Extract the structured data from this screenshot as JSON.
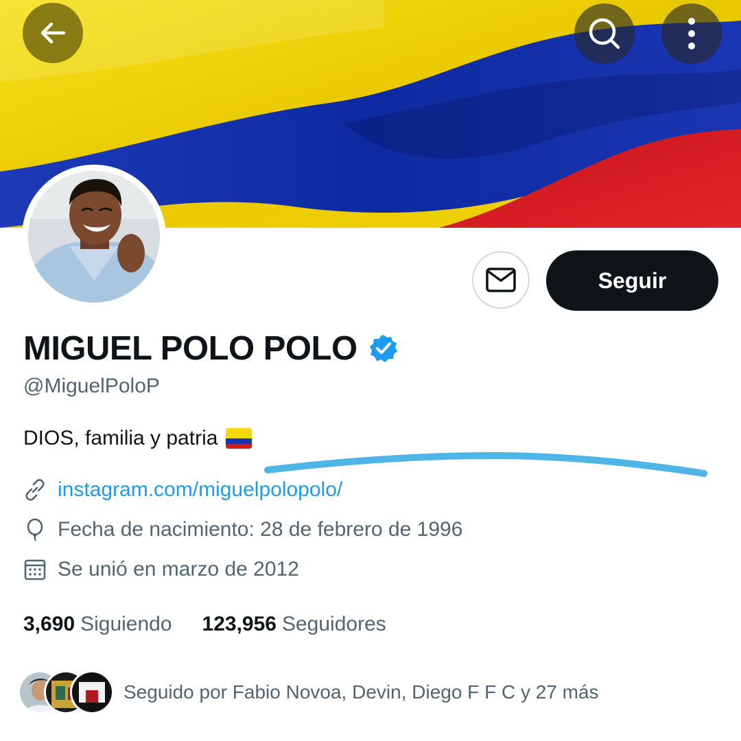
{
  "profile": {
    "name": "MIGUEL POLO POLO",
    "handle": "@MiguelPoloP",
    "bio": "DIOS, familia y patria",
    "link": "instagram.com/miguelpolopolo/",
    "birthday": "Fecha de nacimiento: 28 de febrero de 1996",
    "joined": "Se unió en marzo de 2012",
    "following_count": "3,690",
    "following_label": "Siguiendo",
    "followers_count": "123,956",
    "followers_label": "Seguidores",
    "followed_by": "Seguido por Fabio Novoa, Devin, Diego F F C y 27 más",
    "verified": true
  },
  "actions": {
    "follow_label": "Seguir"
  },
  "icons": {
    "back": "arrow-left-icon",
    "search": "search-icon",
    "more": "more-vertical-icon",
    "message": "envelope-icon",
    "verified": "verified-badge-icon",
    "link": "link-icon",
    "birthday": "balloon-icon",
    "joined": "calendar-icon"
  },
  "colors": {
    "accent": "#1d9bf0",
    "flag_yellow": "#f5d90a",
    "flag_blue": "#1a33a8",
    "flag_red": "#d11a1a",
    "follow_button": "#0f1419",
    "secondary_text": "#536471"
  }
}
